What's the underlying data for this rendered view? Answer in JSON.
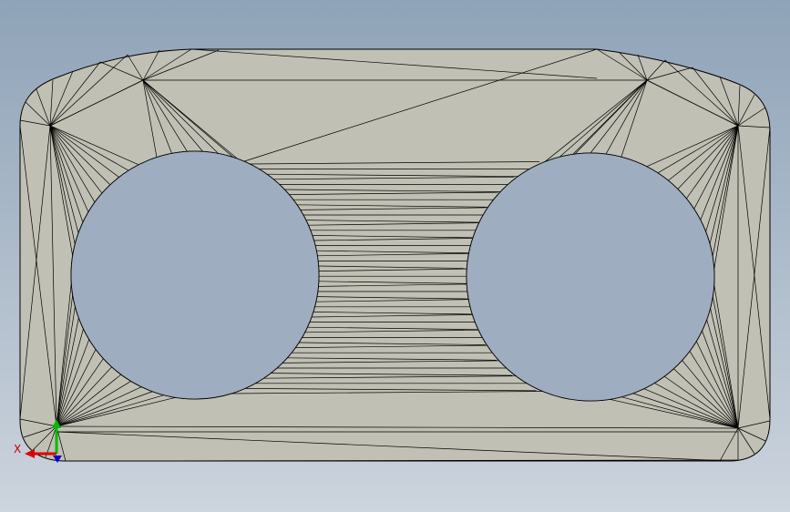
{
  "viewport": {
    "background_top": "#8fa3b8",
    "background_bottom": "#ccd4dd",
    "part_fill": "#c0c0b4",
    "edge_color": "#000000",
    "hole_fill": "#9eadbf"
  },
  "triad": {
    "x_label": "X",
    "x_color": "#dd0000",
    "y_color": "#00bb00",
    "z_color": "#0000cc"
  }
}
